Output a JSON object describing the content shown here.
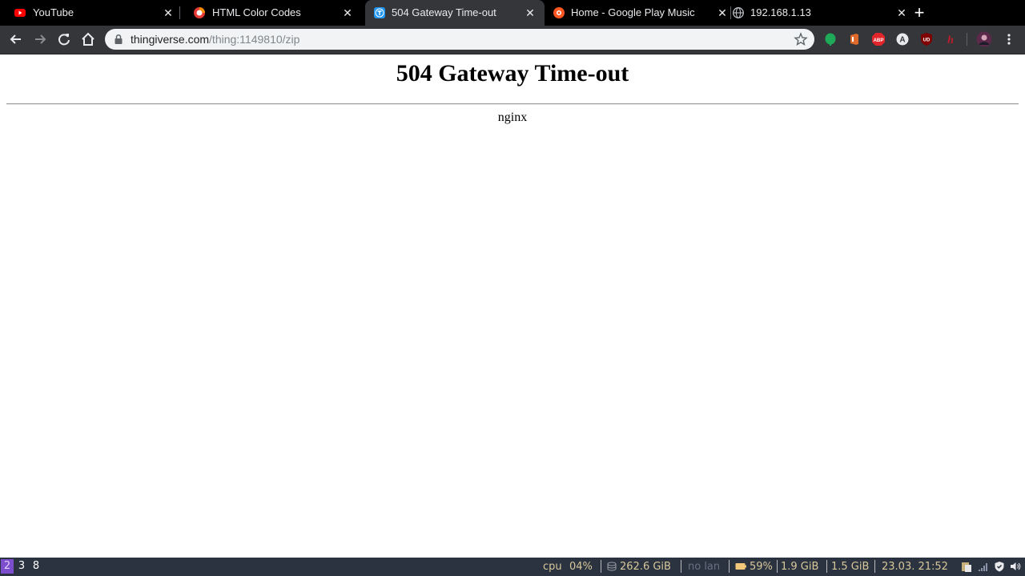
{
  "tabs": [
    {
      "title": "YouTube",
      "favicon": "youtube-icon",
      "active": false
    },
    {
      "title": "HTML Color Codes",
      "favicon": "html-color-codes-icon",
      "active": false
    },
    {
      "title": "504 Gateway Time-out",
      "favicon": "thingiverse-icon",
      "active": true
    },
    {
      "title": "Home - Google Play Music",
      "favicon": "google-play-music-icon",
      "active": false
    },
    {
      "title": "192.168.1.13",
      "favicon": "globe-icon",
      "active": false
    }
  ],
  "tab_close_glyph": "✕",
  "new_tab_glyph": "+",
  "omnibox": {
    "host": "thingiverse.com",
    "path": "/thing:1149810/zip"
  },
  "extensions": {
    "abp": "ABP",
    "a": "A",
    "ud": "UD",
    "h": "h"
  },
  "page": {
    "heading": "504 Gateway Time-out",
    "server": "nginx"
  },
  "statusbar": {
    "workspaces": [
      "2",
      "3",
      "8"
    ],
    "active_workspace": "2",
    "cpu_label": "cpu",
    "cpu_value": "04%",
    "disk": "262.6 GiB",
    "lan": "no lan",
    "battery": "59%",
    "mem_used": "1.9 GiB",
    "mem_free": "1.5 GiB",
    "datetime": "23.03. 21:52"
  },
  "colors": {
    "tabstrip": "#000000",
    "toolbar": "#35363a",
    "statusbar": "#2b3240",
    "active_workspace": "#7c4dcc"
  }
}
